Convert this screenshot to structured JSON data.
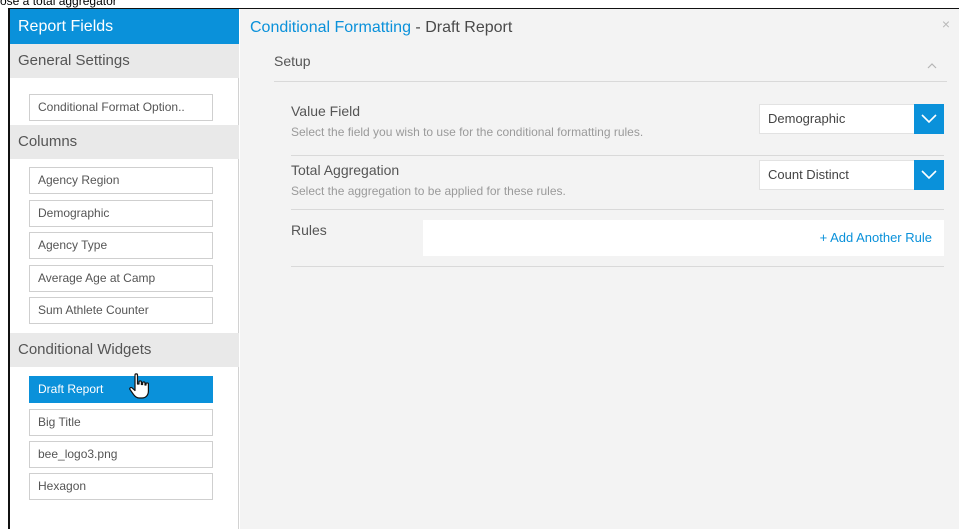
{
  "caption": "ose a total aggregator",
  "left_panel": {
    "header": "Report Fields",
    "sections": {
      "general": {
        "title": "General Settings",
        "items": [
          "Conditional Format Option.."
        ]
      },
      "columns": {
        "title": "Columns",
        "items": [
          "Agency Region",
          "Demographic",
          "Agency Type",
          "Average Age at Camp",
          "Sum Athlete Counter"
        ]
      },
      "widgets": {
        "title": "Conditional Widgets",
        "items": [
          "Draft Report",
          "Big Title",
          "bee_logo3.png",
          "Hexagon"
        ],
        "selected_index": 0
      }
    }
  },
  "right_panel": {
    "title_accent": "Conditional Formatting",
    "title_rest": " - Draft Report",
    "close_icon": "×",
    "setup_label": "Setup",
    "value_field": {
      "title": "Value Field",
      "subtitle": "Select the field you wish to use for the conditional formatting rules.",
      "selected": "Demographic"
    },
    "total_aggregation": {
      "title": "Total Aggregation",
      "subtitle": "Select the aggregation to be applied for these rules.",
      "selected": "Count Distinct"
    },
    "rules": {
      "title": "Rules",
      "add_label": "+ Add Another Rule"
    }
  },
  "colors": {
    "accent": "#0a91da",
    "section_bg": "#e9e9e9",
    "panel_bg": "#f3f3f3"
  },
  "icons": {
    "close": "close-icon",
    "collapse": "chevron-up-icon",
    "dropdown": "chevron-down-icon",
    "cursor": "hand-pointer-icon"
  }
}
